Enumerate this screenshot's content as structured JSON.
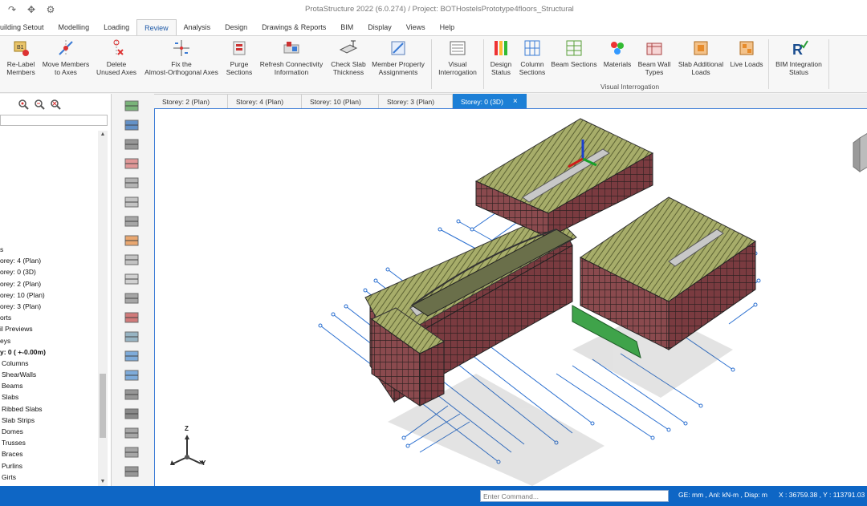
{
  "window": {
    "title": "ProtaStructure 2022 (6.0.274) / Project: BOTHostelsPrototype4floors_Structural"
  },
  "tabs": [
    {
      "label": "uilding Setout"
    },
    {
      "label": "Modelling"
    },
    {
      "label": "Loading"
    },
    {
      "label": "Review"
    },
    {
      "label": "Analysis"
    },
    {
      "label": "Design"
    },
    {
      "label": "Drawings & Reports"
    },
    {
      "label": "BIM"
    },
    {
      "label": "Display"
    },
    {
      "label": "Views"
    },
    {
      "label": "Help"
    }
  ],
  "ribbon": {
    "buttons": [
      {
        "l1": "Re-Label",
        "l2": "Members"
      },
      {
        "l1": "Move Members",
        "l2": "to Axes"
      },
      {
        "l1": "Delete",
        "l2": "Unused Axes"
      },
      {
        "l1": "Fix the",
        "l2": "Almost-Orthogonal Axes"
      },
      {
        "l1": "Purge",
        "l2": "Sections"
      },
      {
        "l1": "Refresh Connectivity",
        "l2": "Information"
      },
      {
        "l1": "Check Slab",
        "l2": "Thickness"
      },
      {
        "l1": "Member Property",
        "l2": "Assignments"
      },
      {
        "l1": "Visual",
        "l2": "Interrogation"
      },
      {
        "l1": "Design",
        "l2": "Status"
      },
      {
        "l1": "Column",
        "l2": "Sections"
      },
      {
        "l1": "Beam Sections",
        "l2": ""
      },
      {
        "l1": "Materials",
        "l2": ""
      },
      {
        "l1": "Beam Wall",
        "l2": "Types"
      },
      {
        "l1": "Slab Additional",
        "l2": "Loads"
      },
      {
        "l1": "Live Loads",
        "l2": ""
      },
      {
        "l1": "BIM Integration",
        "l2": "Status"
      }
    ],
    "group_label": "Visual Interrogation"
  },
  "tree": {
    "items": [
      {
        "label": "s"
      },
      {
        "label": "orey: 4 (Plan)"
      },
      {
        "label": "orey: 0 (3D)"
      },
      {
        "label": "orey: 2 (Plan)"
      },
      {
        "label": "orey: 10 (Plan)"
      },
      {
        "label": "orey: 3 (Plan)"
      },
      {
        "label": "orts"
      },
      {
        "label": "il Previews"
      },
      {
        "label": "eys"
      },
      {
        "label": "y: 0 ( +-0.00m)"
      },
      {
        "label": "Columns"
      },
      {
        "label": "ShearWalls"
      },
      {
        "label": "Beams"
      },
      {
        "label": "Slabs"
      },
      {
        "label": "Ribbed Slabs"
      },
      {
        "label": "Slab Strips"
      },
      {
        "label": "Domes"
      },
      {
        "label": "Trusses"
      },
      {
        "label": "Braces"
      },
      {
        "label": "Purlins"
      },
      {
        "label": "Girts"
      }
    ]
  },
  "doc_tabs": [
    {
      "label": "Storey: 2 (Plan)"
    },
    {
      "label": "Storey: 4 (Plan)"
    },
    {
      "label": "Storey: 10 (Plan)"
    },
    {
      "label": "Storey: 3 (Plan)"
    },
    {
      "label": "Storey: 0 (3D)",
      "close": "×"
    }
  ],
  "axes_gizmo": {
    "z": "Z",
    "y": "Y"
  },
  "statusbar": {
    "command_placeholder": "Enter Command...",
    "units": "GE: mm , Anl: kN-m , Disp: m",
    "coords": "X : 36759.38 , Y : 113791.03"
  },
  "icons": {
    "qat": [
      "redo-icon",
      "move-icon",
      "settings-icon"
    ],
    "left_tools": [
      "zoom-find-icon",
      "zoom-find-icon",
      "zoom-clear-icon"
    ]
  },
  "colors": {
    "accent": "#1c7fd6",
    "statusbar": "#0e66c5",
    "active_tab_text": "#1f5aa8"
  }
}
